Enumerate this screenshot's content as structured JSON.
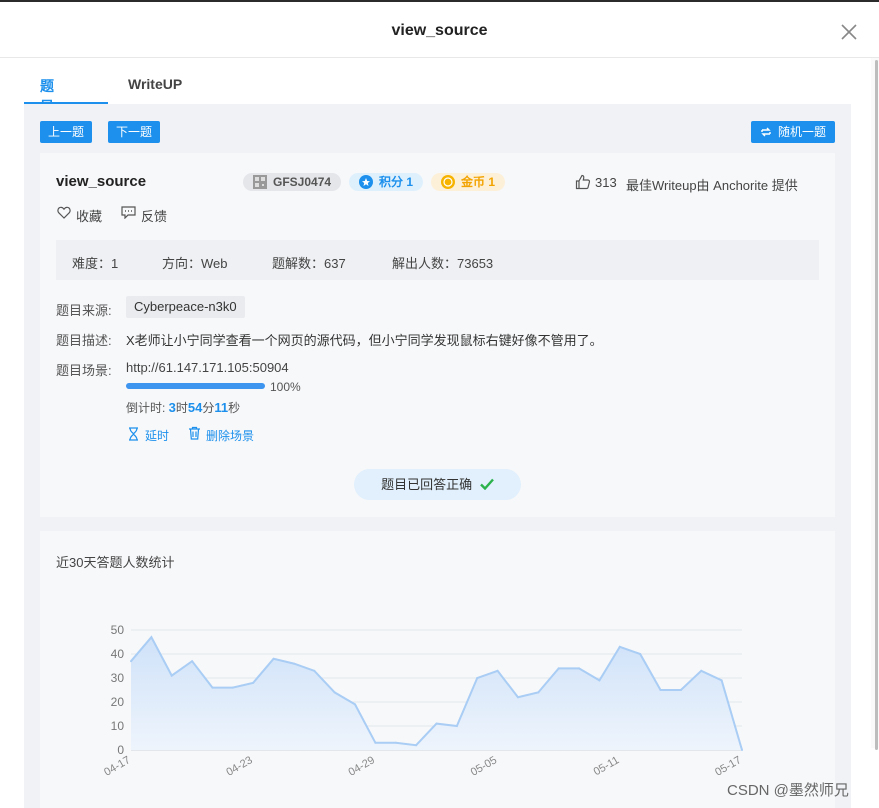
{
  "dialog": {
    "title": "view_source",
    "close_icon": "close-icon"
  },
  "tabs": [
    {
      "label": "题目详情",
      "active": true
    },
    {
      "label": "WriteUP",
      "active": false
    }
  ],
  "toolbar": {
    "prev": "上一题",
    "next": "下一题",
    "random": "随机一题"
  },
  "challenge": {
    "name": "view_source",
    "id_badge": "GFSJ0474",
    "score_badge": "积分 1",
    "coin_badge": "金币 1",
    "likes": "313",
    "best_writeup": "最佳Writeup由 Anchorite 提供",
    "favorite": "收藏",
    "feedback": "反馈"
  },
  "stats": {
    "difficulty": "难度：1",
    "direction": "方向：Web",
    "writeups": "题解数：637",
    "solvers": "解出人数：73653"
  },
  "details": {
    "source_label": "题目来源:",
    "source_value": "Cyberpeace-n3k0",
    "desc_label": "题目描述:",
    "desc_value": "X老师让小宁同学查看一个网页的源代码，但小宁同学发现鼠标右键好像不管用了。",
    "scene_label": "题目场景:",
    "scene_url": "http://61.147.171.105:50904",
    "progress_label": "100%",
    "progress_value": 1.0,
    "countdown_prefix": "倒计时: ",
    "countdown_h": "3",
    "countdown_h_unit": "时",
    "countdown_m": "54",
    "countdown_m_unit": "分",
    "countdown_s": "11",
    "countdown_s_unit": "秒",
    "extend": "延时",
    "delete_scene": "删除场景",
    "solved_status": "题目已回答正确"
  },
  "chart_section": {
    "title": "近30天答题人数统计"
  },
  "chart_data": {
    "type": "area",
    "title": "近30天答题人数统计",
    "xlabel": "",
    "ylabel": "",
    "ylim": [
      0,
      50
    ],
    "yticks": [
      "50",
      "40",
      "30",
      "20",
      "10",
      "0"
    ],
    "xtick_labels": [
      "04-17",
      "04-23",
      "04-29",
      "05-05",
      "05-11",
      "05-17"
    ],
    "x": [
      "04-17",
      "04-18",
      "04-19",
      "04-20",
      "04-21",
      "04-22",
      "04-23",
      "04-24",
      "04-25",
      "04-26",
      "04-27",
      "04-28",
      "04-29",
      "04-30",
      "05-01",
      "05-02",
      "05-03",
      "05-04",
      "05-05",
      "05-06",
      "05-07",
      "05-08",
      "05-09",
      "05-10",
      "05-11",
      "05-12",
      "05-13",
      "05-14",
      "05-15",
      "05-16",
      "05-17"
    ],
    "values": [
      37,
      47,
      31,
      37,
      26,
      26,
      28,
      38,
      36,
      33,
      24,
      19,
      3,
      3,
      2,
      11,
      10,
      30,
      33,
      22,
      24,
      34,
      34,
      29,
      43,
      40,
      25,
      25,
      33,
      29,
      0
    ],
    "grid": true,
    "colors": {
      "line": "#a9cdf4",
      "fill_top": "#cfe2f9",
      "fill_bottom": "#eef4fc"
    }
  },
  "watermark": "CSDN @墨然师兄",
  "colors": {
    "accent": "#1c90ec",
    "panel": "#f0f2f5",
    "card": "#f7f8fa"
  }
}
